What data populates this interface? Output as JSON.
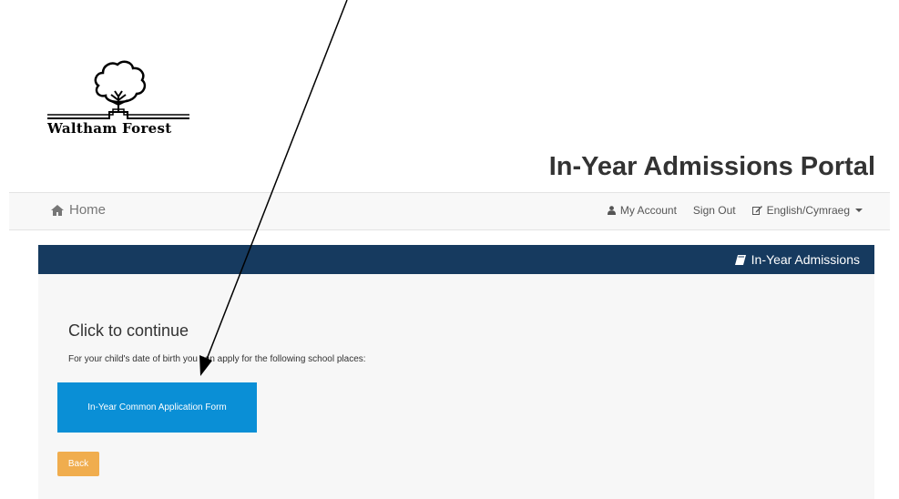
{
  "brand": {
    "logo_text": "Waltham Forest"
  },
  "header": {
    "title": "In-Year Admissions Portal"
  },
  "navbar": {
    "home_label": "Home",
    "account_label": "My Account",
    "signout_label": "Sign Out",
    "language_label": "English/Cymraeg"
  },
  "panel": {
    "header_label": "In-Year Admissions",
    "heading": "Click to continue",
    "text": "For your child's date of birth you can apply for the following school places:",
    "primary_button": "In-Year Common Application Form",
    "back_button": "Back"
  },
  "colors": {
    "panel_header": "#163a5f",
    "primary_button": "#0a8fd6",
    "back_button": "#f0ad4e",
    "annotation_arrow": "#000000"
  },
  "icons": [
    "tree-logo-icon",
    "home-icon",
    "user-icon",
    "edit-icon",
    "book-icon",
    "caret-down-icon"
  ]
}
